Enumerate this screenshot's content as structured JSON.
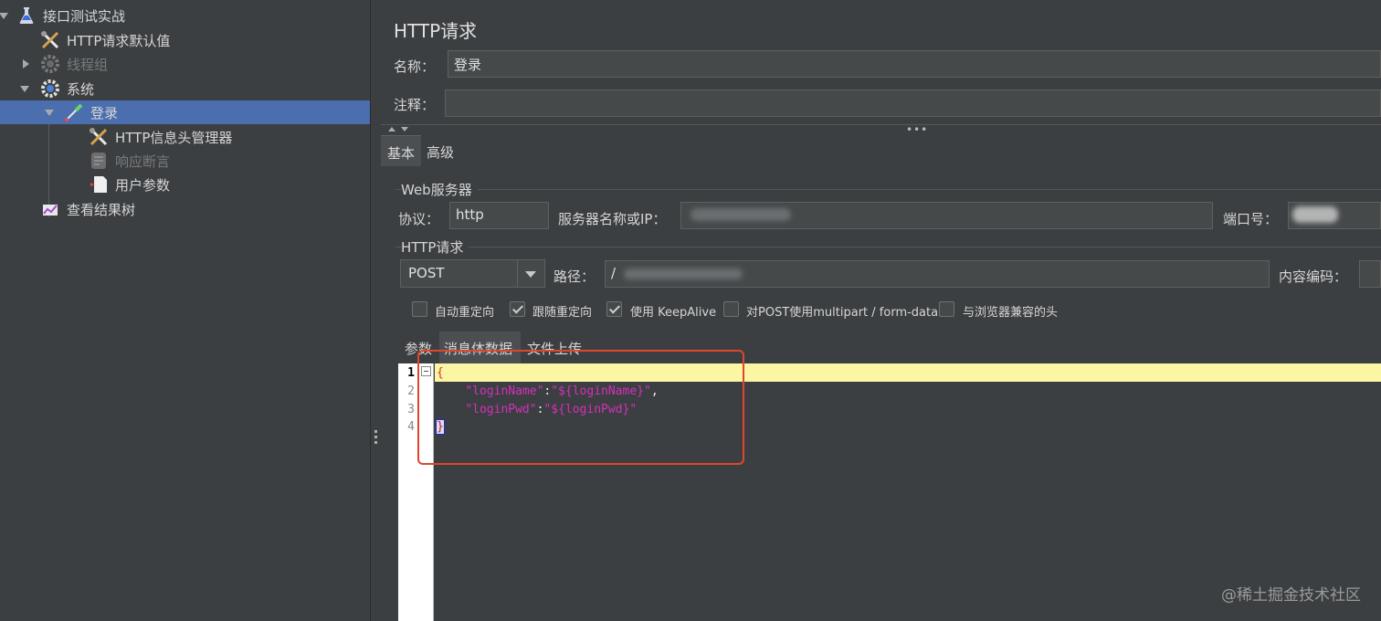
{
  "tree": {
    "items": [
      {
        "label": "接口测试实战"
      },
      {
        "label": "HTTP请求默认值"
      },
      {
        "label": "线程组"
      },
      {
        "label": "系统"
      },
      {
        "label": "登录"
      },
      {
        "label": "HTTP信息头管理器"
      },
      {
        "label": "响应断言"
      },
      {
        "label": "用户参数"
      },
      {
        "label": "查看结果树"
      }
    ]
  },
  "panel": {
    "title": "HTTP请求",
    "name_label": "名称：",
    "name_value": "登录",
    "comment_label": "注释：",
    "comment_value": "",
    "tabs": [
      {
        "label": "基本"
      },
      {
        "label": "高级"
      }
    ],
    "web_server": {
      "title": "Web服务器",
      "protocol_label": "协议：",
      "protocol_value": "http",
      "server_label": "服务器名称或IP：",
      "port_label": "端口号："
    },
    "http_request": {
      "title": "HTTP请求",
      "method": "POST",
      "path_label": "路径：",
      "path_value": "/",
      "encoding_label": "内容编码："
    },
    "options": [
      {
        "label": "自动重定向",
        "checked": false
      },
      {
        "label": "跟随重定向",
        "checked": true
      },
      {
        "label": "使用 KeepAlive",
        "checked": true
      },
      {
        "label": "对POST使用multipart / form-data",
        "checked": false
      },
      {
        "label": "与浏览器兼容的头",
        "checked": false
      }
    ],
    "body_tabs": [
      {
        "label": "参数"
      },
      {
        "label": "消息体数据"
      },
      {
        "label": "文件上传"
      }
    ],
    "editor": {
      "line_numbers": [
        "1",
        "2",
        "3",
        "4"
      ],
      "lines": [
        {
          "open": "{"
        },
        {
          "key": "\"loginName\"",
          "sep": ":",
          "val": "\"${loginName}\"",
          "tail": ","
        },
        {
          "key": "\"loginPwd\"",
          "sep": ":",
          "val": "\"${loginPwd}\"",
          "tail": ""
        },
        {
          "close": "}"
        }
      ]
    }
  },
  "watermark": "@稀土掘金技术社区",
  "colors": {
    "selection": "#4b6eaf",
    "annotation": "#e0452d",
    "json_string": "#d62fbd",
    "current_line": "#fbf6a4"
  }
}
